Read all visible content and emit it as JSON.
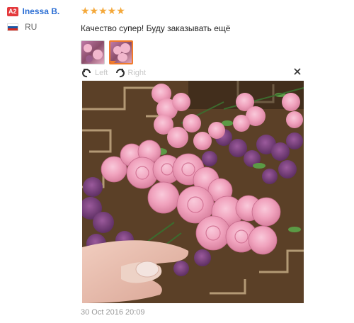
{
  "user": {
    "level": "A2",
    "name": "Inessa B.",
    "country": "RU",
    "flag_colors": [
      "#ffffff",
      "#1c57a5",
      "#d52b1e"
    ]
  },
  "review": {
    "stars": "★★★★★",
    "rating": 5,
    "text": "Качество супер! Буду заказывать ещё",
    "star_color": "#f4a83a"
  },
  "gallery": {
    "thumbnails": [
      "photo-1",
      "photo-2"
    ],
    "active_index": 1,
    "prev_label": "Left",
    "next_label": "Right",
    "prev_icon": "rotate-left-icon",
    "next_icon": "rotate-right-icon",
    "close_icon": "close-icon"
  },
  "date": "30 Oct 2016 20:09"
}
